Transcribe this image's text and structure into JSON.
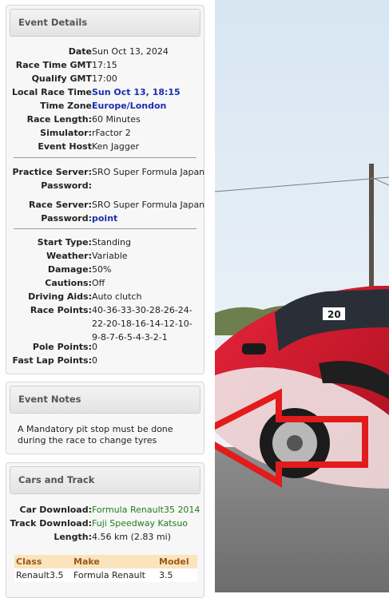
{
  "event_details": {
    "header": "Event Details",
    "rows_a": [
      {
        "label": "Date",
        "value": "Sun Oct 13, 2024",
        "style": ""
      },
      {
        "label": "Race Time GMT",
        "value": "17:15",
        "style": ""
      },
      {
        "label": "Qualify GMT",
        "value": "17:00",
        "style": ""
      },
      {
        "label": "Local Race Time",
        "value": "Sun Oct 13, 18:15",
        "style": "link-blue"
      },
      {
        "label": "Time Zone",
        "value": "Europe/London",
        "style": "link-blue"
      },
      {
        "label": "Race Length:",
        "value": "60 Minutes",
        "style": ""
      },
      {
        "label": "Simulator:",
        "value": "rFactor 2",
        "style": ""
      },
      {
        "label": "Event Host",
        "value": "Ken Jagger",
        "style": ""
      }
    ],
    "practice_server_label": "Practice Server:",
    "practice_server_value": "SRO Super Formula Japan",
    "practice_password_label": "Password:",
    "practice_password_value": "",
    "race_server_label": "Race Server:",
    "race_server_value": "SRO Super Formula Japan",
    "race_password_label": "Password:",
    "race_password_value": "point",
    "rows_c": [
      {
        "label": "Start Type:",
        "value": "Standing"
      },
      {
        "label": "Weather:",
        "value": "Variable"
      },
      {
        "label": "Damage:",
        "value": "50%"
      },
      {
        "label": "Cautions:",
        "value": "Off"
      },
      {
        "label": "Driving Aids:",
        "value": "Auto clutch"
      }
    ],
    "race_points_label": "Race Points:",
    "race_points_value": "40-36-33-30-28-26-24-22-20-18-16-14-12-10-9-8-7-6-5-4-3-2-1",
    "pole_points_label": "Pole Points:",
    "pole_points_value": "0",
    "fast_lap_label": "Fast Lap Points:",
    "fast_lap_value": "0"
  },
  "event_notes": {
    "header": "Event Notes",
    "text": "A Mandatory pit stop must be done during the race to change tyres"
  },
  "cars_track": {
    "header": "Cars and Track",
    "car_download_label": "Car Download:",
    "car_download_value": "Formula Renault35 2014",
    "track_download_label": "Track Download:",
    "track_download_value": "Fuji Speedway Katsuo",
    "length_label": "Length:",
    "length_value": "4.56 km (2.83 mi)",
    "table_headers": [
      "Class",
      "Make",
      "Model"
    ],
    "table_rows": [
      [
        "Renault3.5",
        "Formula Renault",
        "3.5"
      ]
    ]
  },
  "colors": {
    "link_blue": "#1a2fb0",
    "link_green": "#1e7d1e",
    "table_header_bg": "#fbe3bd",
    "arrow_red": "#e21b1b"
  }
}
